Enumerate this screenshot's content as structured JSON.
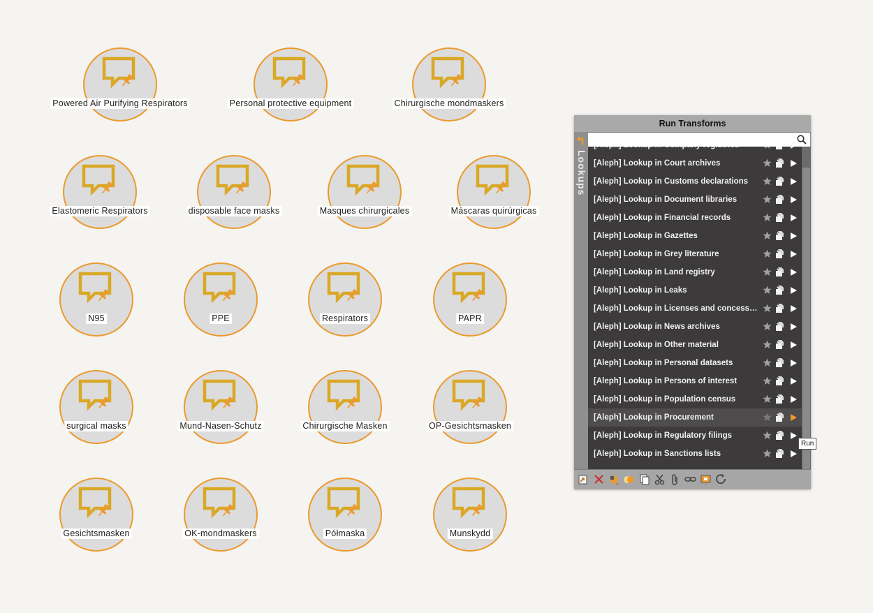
{
  "graph": {
    "nodes": [
      {
        "label": "Powered Air Purifying Respirators"
      },
      {
        "label": "Personal protective equipment"
      },
      {
        "label": "Chirurgische mondmaskers"
      },
      {
        "label": "Elastomeric Respirators"
      },
      {
        "label": "disposable face masks"
      },
      {
        "label": "Masques chirurgicales"
      },
      {
        "label": "Máscaras quirúrgicas"
      },
      {
        "label": "N95"
      },
      {
        "label": "PPE"
      },
      {
        "label": "Respirators"
      },
      {
        "label": "PAPR"
      },
      {
        "label": "surgical masks"
      },
      {
        "label": "Mund-Nasen-Schutz"
      },
      {
        "label": "Chirurgische Masken"
      },
      {
        "label": "OP-Gesichtsmasken"
      },
      {
        "label": "Gesichtsmasken"
      },
      {
        "label": "OK-mondmaskers"
      },
      {
        "label": "Półmaska"
      },
      {
        "label": "Munskydd"
      }
    ],
    "node_icon": "speech-bubble-pin-icon",
    "node_border_color": "#eb9a2f",
    "node_icon_color": "#d9a826"
  },
  "panel": {
    "title": "Run Transforms",
    "side_tab_label": "Lookups",
    "search": {
      "value": "",
      "placeholder": ""
    },
    "transforms": [
      {
        "label": "[Aleph] Lookup in Company registries"
      },
      {
        "label": "[Aleph] Lookup in Court archives"
      },
      {
        "label": "[Aleph] Lookup in Customs declarations"
      },
      {
        "label": "[Aleph] Lookup in Document libraries"
      },
      {
        "label": "[Aleph] Lookup in Financial records"
      },
      {
        "label": "[Aleph] Lookup in Gazettes"
      },
      {
        "label": "[Aleph] Lookup in Grey literature"
      },
      {
        "label": "[Aleph] Lookup in Land registry"
      },
      {
        "label": "[Aleph] Lookup in Leaks"
      },
      {
        "label": "[Aleph] Lookup in Licenses and concessions"
      },
      {
        "label": "[Aleph] Lookup in News archives"
      },
      {
        "label": "[Aleph] Lookup in Other material"
      },
      {
        "label": "[Aleph] Lookup in Personal datasets"
      },
      {
        "label": "[Aleph] Lookup in Persons of interest"
      },
      {
        "label": "[Aleph] Lookup in Population census"
      },
      {
        "label": "[Aleph] Lookup in Procurement",
        "active": true
      },
      {
        "label": "[Aleph] Lookup in Regulatory filings"
      },
      {
        "label": "[Aleph] Lookup in Sanctions lists"
      }
    ],
    "toolbar_icons": [
      "export-icon",
      "delete-icon",
      "color-icon",
      "merge-icon",
      "copy-icon",
      "cut-icon",
      "attach-icon",
      "link-icon",
      "bookmark-icon",
      "refresh-icon"
    ],
    "tooltip": "Run",
    "accent_color": "#eb9a2f"
  }
}
